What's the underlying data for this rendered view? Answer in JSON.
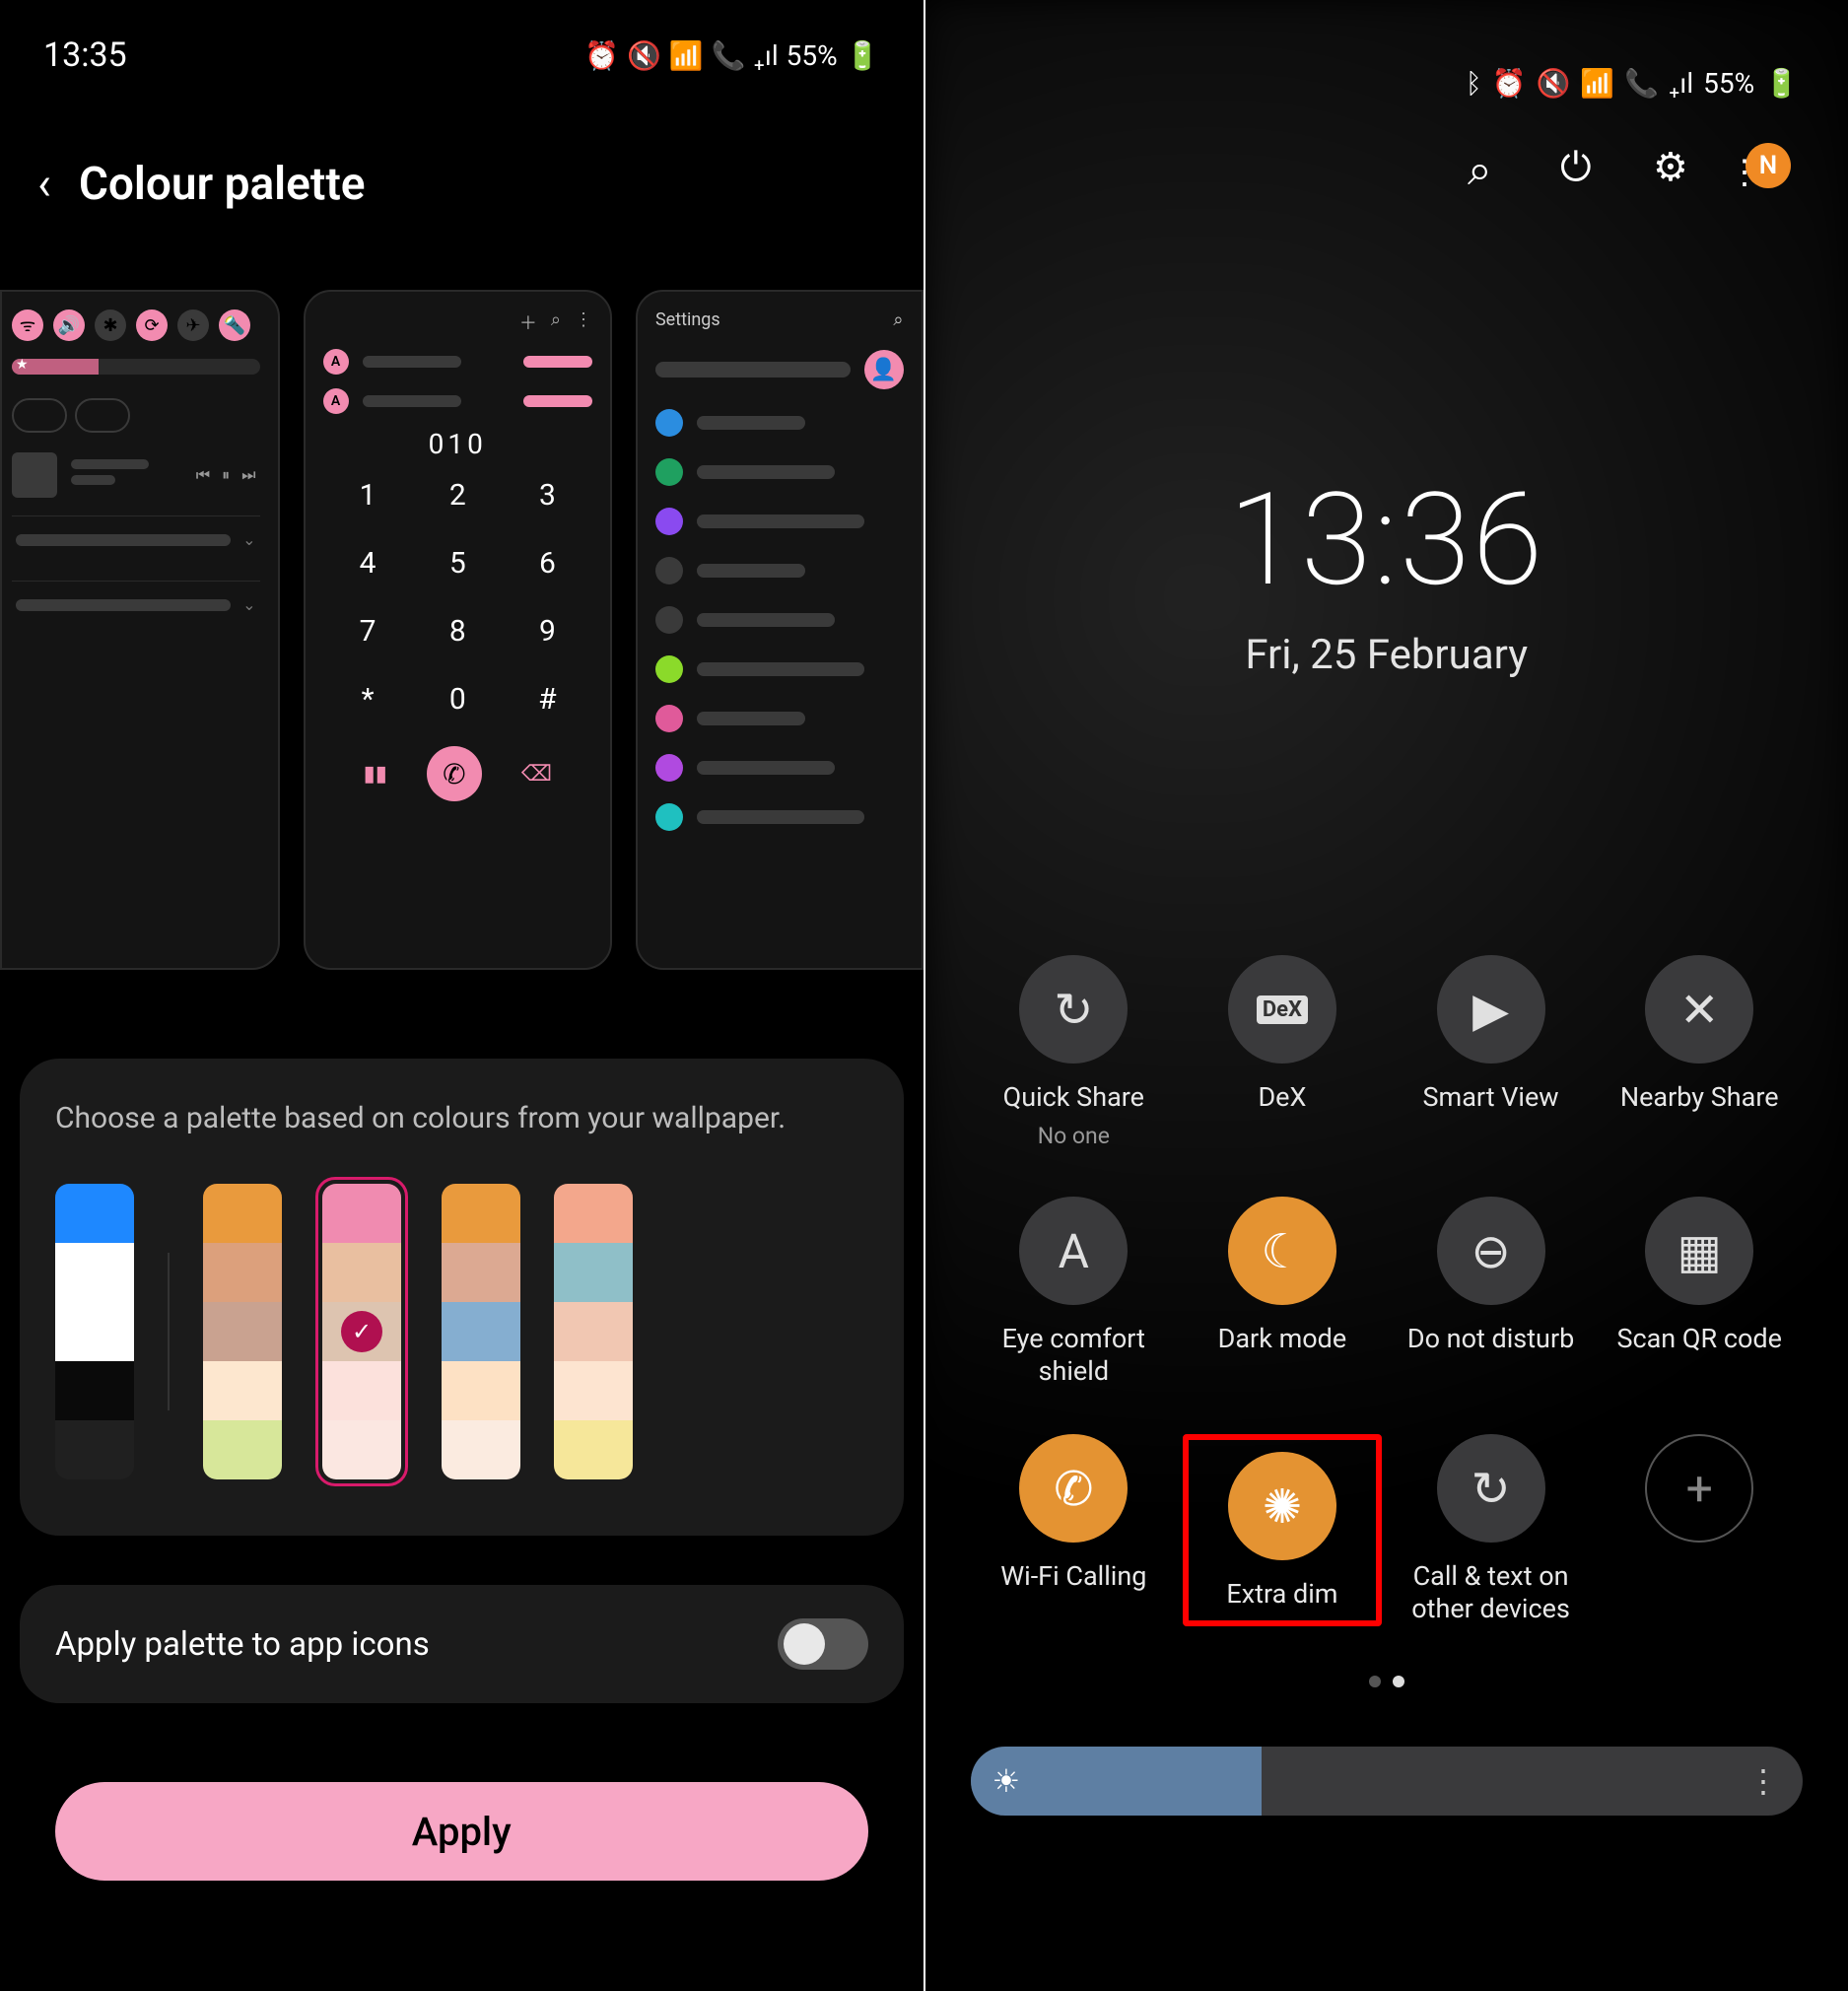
{
  "left": {
    "status": {
      "time": "13:35",
      "battery": "55%"
    },
    "title": "Colour palette",
    "previews": {
      "dialer_number": "010",
      "dialer_keys": [
        "1",
        "2",
        "3",
        "4",
        "5",
        "6",
        "7",
        "8",
        "9",
        "*",
        "0",
        "#"
      ],
      "contact_letter": "A",
      "settings_label": "Settings",
      "list_colors": [
        "#2b8de0",
        "#1fa060",
        "#8a4af0",
        "#3a3a3a",
        "#3a3a3a",
        "#8bda2a",
        "#e05a9a",
        "#b04ae0",
        "#1fc0c0"
      ]
    },
    "palette": {
      "desc": "Choose a palette based on colours from your wallpaper.",
      "selected_index": 2,
      "swatches": [
        {
          "colors": [
            "#1e88ff",
            "#ffffff",
            "#ffffff",
            "#0a0a0a",
            "#202020"
          ]
        },
        {
          "colors": [
            "#e99a3d",
            "#dca07c",
            "#c9a290",
            "#fde7cf",
            "#d7e79a"
          ]
        },
        {
          "colors": [
            "#f08bb0",
            "#e9bfa0",
            "#ddc4b0",
            "#fce1dc",
            "#fbe7e1"
          ]
        },
        {
          "colors": [
            "#e99a3d",
            "#dca992",
            "#85aed0",
            "#fde1c4",
            "#fbebe0"
          ]
        },
        {
          "colors": [
            "#f3a78c",
            "#8fbfc8",
            "#f1c7b2",
            "#fde4d0",
            "#f6e79a"
          ]
        }
      ]
    },
    "toggle_label": "Apply palette to app icons",
    "apply_label": "Apply"
  },
  "right": {
    "status": {
      "battery": "55%"
    },
    "avatar_letter": "N",
    "clock": {
      "time": "13:36",
      "date": "Fri, 25 February"
    },
    "tiles": [
      {
        "id": "quick-share",
        "label": "Quick Share",
        "sub": "No one",
        "icon": "↻",
        "active": false
      },
      {
        "id": "dex",
        "label": "DeX",
        "icon": "DeX",
        "active": false
      },
      {
        "id": "smart-view",
        "label": "Smart View",
        "icon": "▶",
        "active": false
      },
      {
        "id": "nearby-share",
        "label": "Nearby Share",
        "icon": "✕",
        "active": false
      },
      {
        "id": "eye-comfort",
        "label": "Eye comfort shield",
        "icon": "A",
        "active": false
      },
      {
        "id": "dark-mode",
        "label": "Dark mode",
        "icon": "☾",
        "active": true
      },
      {
        "id": "dnd",
        "label": "Do not disturb",
        "icon": "⊖",
        "active": false
      },
      {
        "id": "scan-qr",
        "label": "Scan QR code",
        "icon": "▦",
        "active": false
      },
      {
        "id": "wifi-calling",
        "label": "Wi-Fi Calling",
        "icon": "✆",
        "active": true
      },
      {
        "id": "extra-dim",
        "label": "Extra dim",
        "icon": "✺",
        "active": true,
        "highlighted": true
      },
      {
        "id": "call-text",
        "label": "Call & text on other devices",
        "icon": "↻",
        "active": false
      },
      {
        "id": "add",
        "label": "",
        "icon": "+",
        "active": false,
        "plus": true
      }
    ],
    "brightness_pct": 35
  }
}
